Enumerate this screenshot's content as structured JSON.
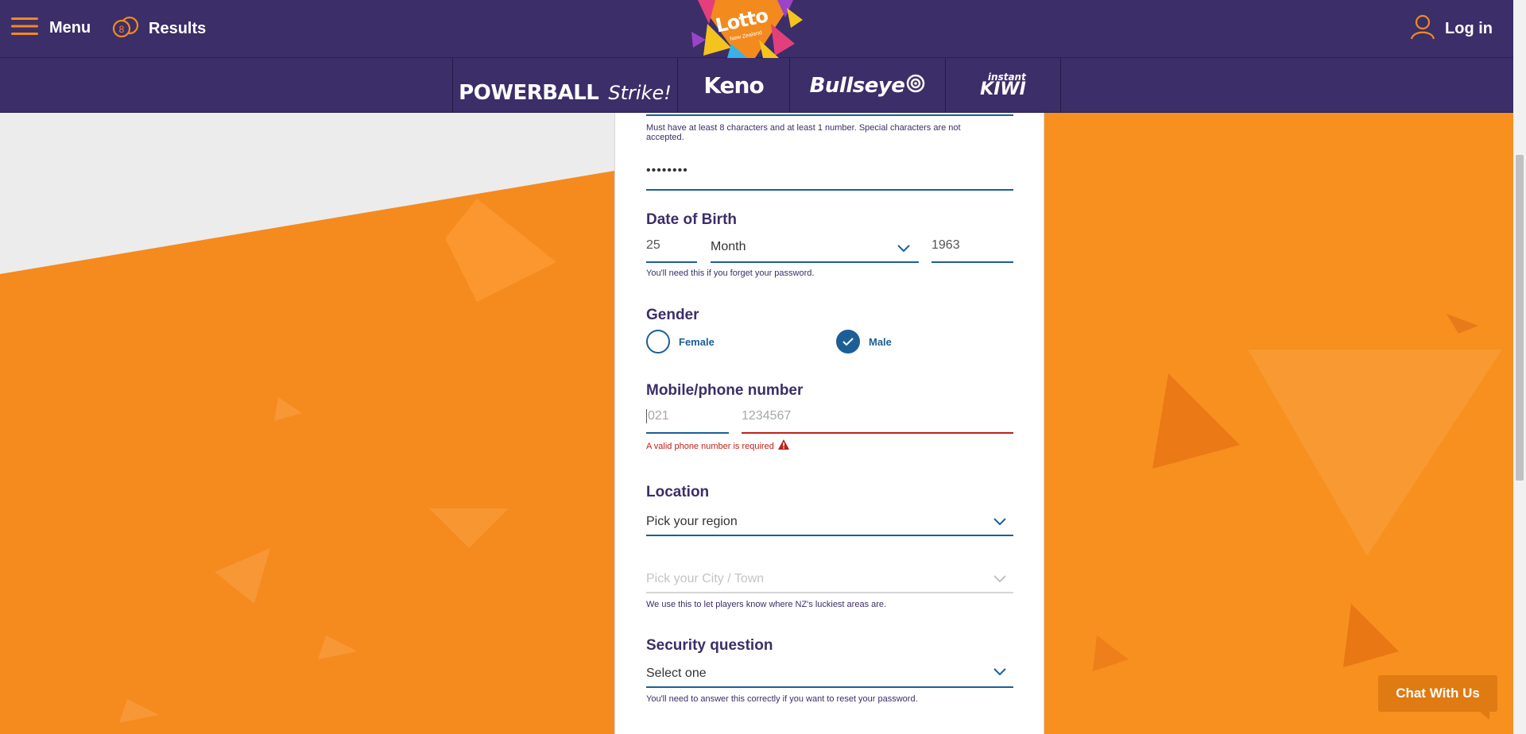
{
  "header": {
    "menu_label": "Menu",
    "results_label": "Results",
    "login_label": "Log in",
    "logo_text": "Lotto",
    "logo_sub": "New Zealand"
  },
  "games": {
    "powerball": "POWERBALL",
    "strike": "Strike!",
    "keno": "Keno",
    "bullseye": "Bullseye",
    "kiwi_small": "instant",
    "kiwi": "KIWI"
  },
  "form": {
    "password_hint": "Must have at least 8 characters and at least 1 number. Special characters are not accepted.",
    "password_confirm_value": "••••••••",
    "dob": {
      "title": "Date of Birth",
      "day": "25",
      "month": "Month",
      "year": "1963",
      "hint": "You'll need this if you forget your password."
    },
    "gender": {
      "title": "Gender",
      "female": "Female",
      "male": "Male",
      "selected": "Male"
    },
    "phone": {
      "title": "Mobile/phone number",
      "prefix_placeholder": "021",
      "number_placeholder": "1234567",
      "error": "A valid phone number is required"
    },
    "location": {
      "title": "Location",
      "region": "Pick your region",
      "city_placeholder": "Pick your City / Town",
      "hint": "We use this to let players know where NZ's luckiest areas are."
    },
    "security": {
      "title": "Security question",
      "select": "Select one",
      "hint": "You'll need to answer this correctly if you want to reset your password."
    }
  },
  "chat": {
    "label": "Chat With Us"
  },
  "colors": {
    "header_bg": "#3c2e68",
    "accent_orange": "#f28a1e",
    "field_blue": "#1c5f96",
    "error_red": "#c0201a"
  }
}
